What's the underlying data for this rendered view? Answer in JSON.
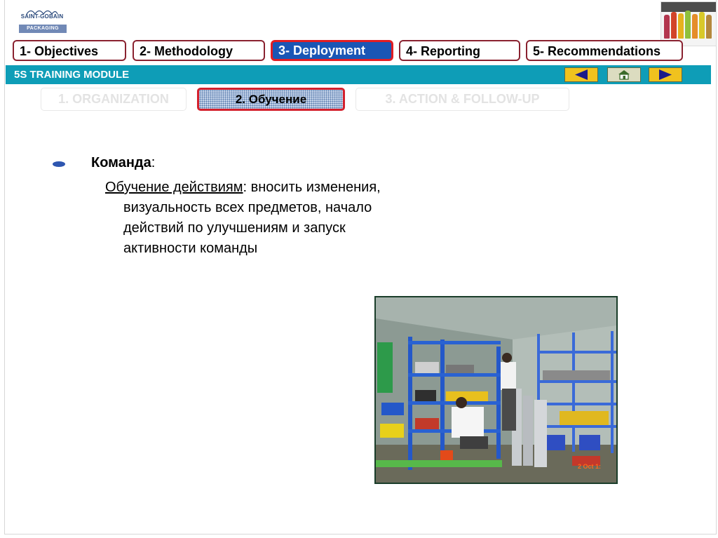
{
  "logo": {
    "brand": "SAINT-GOBAIN",
    "sub": "PACKAGING"
  },
  "tabs": [
    {
      "label": "1- Objectives",
      "active": false
    },
    {
      "label": "2- Methodology",
      "active": false
    },
    {
      "label": "3- Deployment",
      "active": true
    },
    {
      "label": "4- Reporting",
      "active": false
    },
    {
      "label": "5- Recommendations",
      "active": false
    }
  ],
  "module": {
    "title": "5S TRAINING MODULE"
  },
  "nav_icons": [
    "left-arrow-icon",
    "home-icon",
    "right-arrow-icon"
  ],
  "subtabs": [
    {
      "label": "1. ORGANIZATION",
      "active": false
    },
    {
      "label": "2. Обучение",
      "active": true
    },
    {
      "label": "3. ACTION & FOLLOW-UP",
      "active": false
    }
  ],
  "content": {
    "heading": "Команда",
    "heading_suffix": ":",
    "term": "Обучение действиям",
    "lines": [
      ": вносить изменения,",
      "визуальность всех предметов, начало",
      "действий по улучшениям и запуск",
      "активности команды"
    ]
  },
  "photo": {
    "stamp": "2 Oct 1:"
  },
  "colors": {
    "module_bar": "#0e9db7",
    "active_tab": "#1a56b5",
    "tab_border": "#8a2230",
    "active_border": "#e21d23",
    "arrow_button": "#f0c21e",
    "bullet": "#2e56b0"
  }
}
